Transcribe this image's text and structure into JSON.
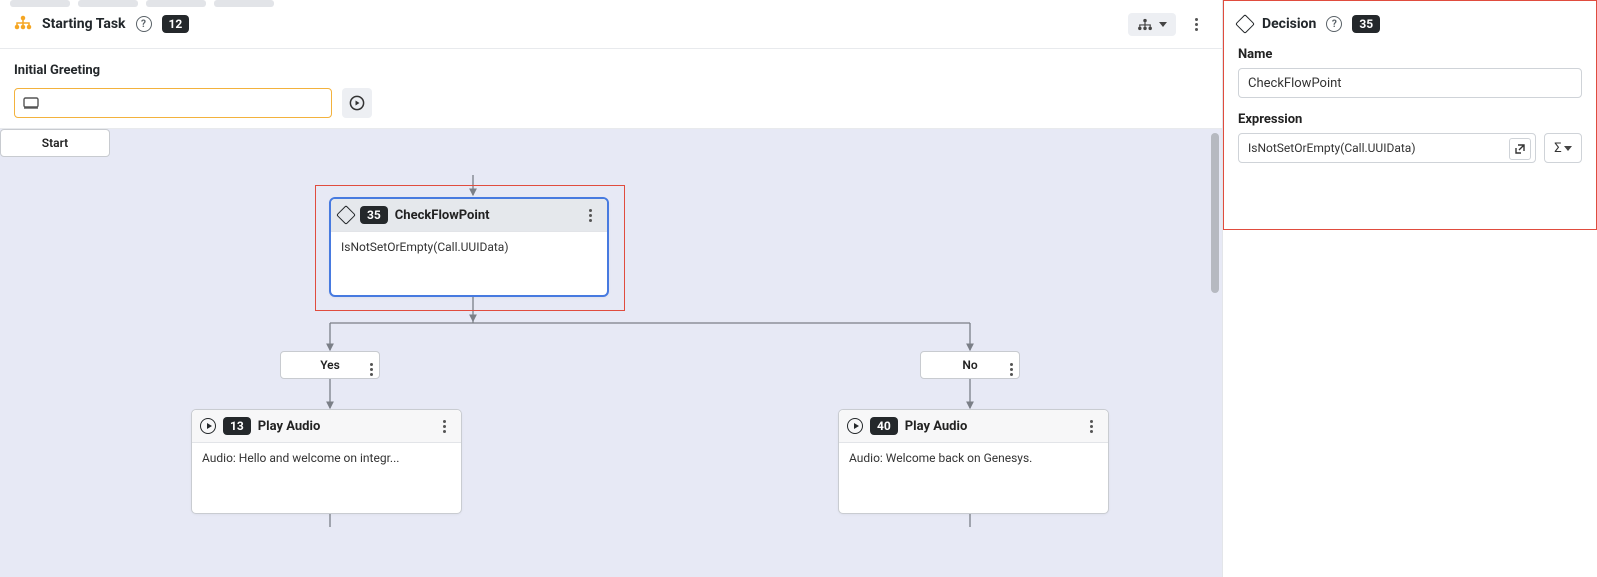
{
  "header": {
    "title": "Starting Task",
    "badge": "12"
  },
  "greeting": {
    "label": "Initial Greeting"
  },
  "canvas": {
    "start": {
      "label": "Start"
    },
    "decision": {
      "id": "35",
      "name": "CheckFlowPoint",
      "expression": "IsNotSetOrEmpty(Call.UUIData)"
    },
    "branches": {
      "yes": "Yes",
      "no": "No"
    },
    "playYes": {
      "id": "13",
      "name": "Play Audio",
      "body": "Audio: Hello and welcome on integr..."
    },
    "playNo": {
      "id": "40",
      "name": "Play Audio",
      "body": "Audio: Welcome back on Genesys."
    }
  },
  "panel": {
    "title": "Decision",
    "id": "35",
    "fields": {
      "name_label": "Name",
      "name_value": "CheckFlowPoint",
      "expr_label": "Expression",
      "expr_value": "IsNotSetOrEmpty(Call.UUIData)"
    },
    "sigma": "Σ"
  }
}
